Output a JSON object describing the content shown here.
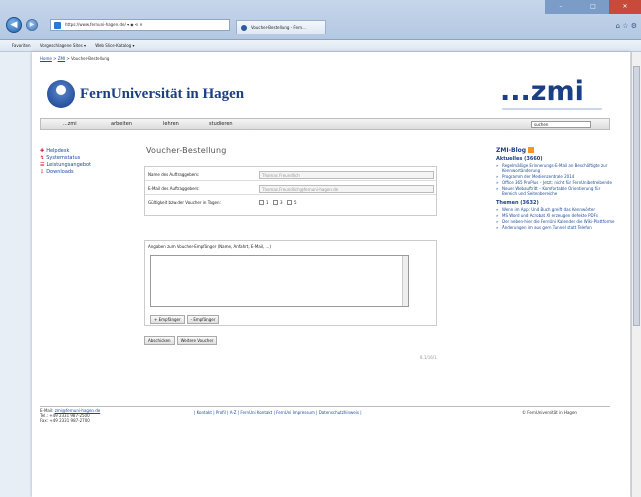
{
  "browser": {
    "url": "https://www.fernuni-hagen.de/ ▾ ◆ ⟲ ✕",
    "tab_label": "Voucher-Bestellung - Fern...",
    "win_min": "–",
    "win_max": "□",
    "win_close": "✕",
    "favorites": [
      "Favoriten",
      "Vorgeschlagene Sites ▾",
      "Web Slice-Katalog ▾"
    ]
  },
  "page": {
    "breadcrumb": {
      "home": "Home",
      "sep1": " > ",
      "zmi": "ZMI",
      "sep2": " > ",
      "current": "Voucher-Bestellung"
    },
    "logo_text": "FernUniversität in Hagen",
    "zmi_logo": "...zmi",
    "nav": [
      "...zmi",
      "arbeiten",
      "lehren",
      "studieren"
    ],
    "search_value": "suchen",
    "sidebar": [
      {
        "icon": "plus-icon",
        "label": "Helpdesk"
      },
      {
        "icon": "status-icon",
        "label": "Systemstatus"
      },
      {
        "icon": "list-icon",
        "label": "Leistungsangebot"
      },
      {
        "icon": "download-icon",
        "label": "Downloads"
      }
    ],
    "content_title": "Voucher-Bestellung",
    "form": {
      "name_label": "Name des Auftraggebers:",
      "name_value": "Thomas Freundlich",
      "email_label": "E-Mail des Auftraggebers:",
      "email_value": "Thomas.Freundlich@fernuni-hagen.de",
      "days_label": "Gültigkeit bzw.der Voucher in Tagen:",
      "day_options": [
        "1",
        "3",
        "5"
      ]
    },
    "recipients": {
      "label": "Angaben zum Voucher-Empfänger (Name, Anfahrt, E-Mail, ...)",
      "add_button": "+ Empfänger",
      "remove_button": "- Empfänger"
    },
    "submit_button": "Abschicken",
    "reset_button": "Weitere Voucher",
    "form_id": "8.1/16/1",
    "blog": {
      "title": "ZMI-Blog",
      "section1": "Aktuelles (3660)",
      "items1": [
        "Regelmäßige Erinnerungs-E-Mail an Beschäftigte zur Kennwortänderung",
        "Programm der Medienzentrale 2014",
        "Office 365 ProPlus – Jetzt: nicht für FernUnibetreibende",
        "Neuer Webauftritt – Komfortable Orientierung für Bereich und Seitenbereiche"
      ],
      "section2": "Themen (3632)",
      "items2": [
        "Wenn im App: Und Buch greift das Kennwörter",
        "MS Word und Acrobat XI erzeugen defekte PDFs",
        "Der neben-hier die FernUni Kalender die Wiki-Plattforme",
        "Änderungen im aus gern Tunnel statt Telefon"
      ]
    },
    "footer": {
      "line1_label": "E-Mail: ",
      "line1_email": "zmi@fernuni-hagen.de",
      "line2": "Tel.: +49 2331 987-2500",
      "line3": "Fax: +49 2331 987-2700",
      "links": "| Kontakt | Profil | A-Z | FernUni Kontakt | FernUni Impressum | Datenschutzhinweis |",
      "copyright": "© FernUniversität in Hagen"
    }
  }
}
